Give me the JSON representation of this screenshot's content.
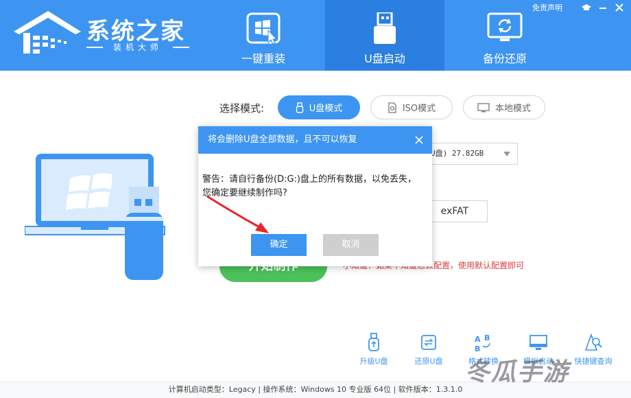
{
  "header": {
    "logo_title": "系统之家",
    "logo_subtitle": "装机大师",
    "top_link": "免责声明",
    "tabs": [
      {
        "label": "一键重装",
        "icon": "windows-cursor-icon"
      },
      {
        "label": "U盘启动",
        "icon": "usb-drive-icon"
      },
      {
        "label": "备份还原",
        "icon": "backup-restore-icon"
      }
    ],
    "active_tab": 1
  },
  "main": {
    "mode_label": "选择模式:",
    "modes": [
      {
        "label": "U盘模式",
        "icon": "usb-icon"
      },
      {
        "label": "ISO模式",
        "icon": "iso-file-icon"
      },
      {
        "label": "本地模式",
        "icon": "monitor-icon"
      }
    ],
    "selected_mode": 0,
    "device_value": "U盘) 27.82GB",
    "filesystem_value": "exFAT",
    "start_label": "开始制作",
    "hint": "小知道：如果不知道怎么配置，使用默认配置即可"
  },
  "tools": [
    {
      "label": "升级U盘",
      "icon": "usb-upgrade-icon"
    },
    {
      "label": "还原U盘",
      "icon": "restore-icon"
    },
    {
      "label": "格式转换",
      "icon": "format-convert-icon"
    },
    {
      "label": "模拟启动",
      "icon": "simulate-boot-icon"
    },
    {
      "label": "快捷键查询",
      "icon": "hotkey-search-icon"
    }
  ],
  "statusbar": {
    "text": "计算机启动类型：Legacy | 操作系统：Windows 10 专业版 64位 | 软件版本：1.3.1.0"
  },
  "dialog": {
    "title": "将会删除U盘全部数据，且不可以恢复",
    "message": "警告：请自行备份(D:G:)盘上的所有数据，以免丢失，您确定要继续制作吗?",
    "ok_label": "确定",
    "cancel_label": "取消"
  },
  "watermark": "冬瓜手游",
  "colors": {
    "primary": "#3d95f1",
    "primary_dark": "#2a7fe0",
    "start_green": "#4cc15a",
    "hint_red": "#e33c3c",
    "arrow_red": "#e8232a"
  }
}
